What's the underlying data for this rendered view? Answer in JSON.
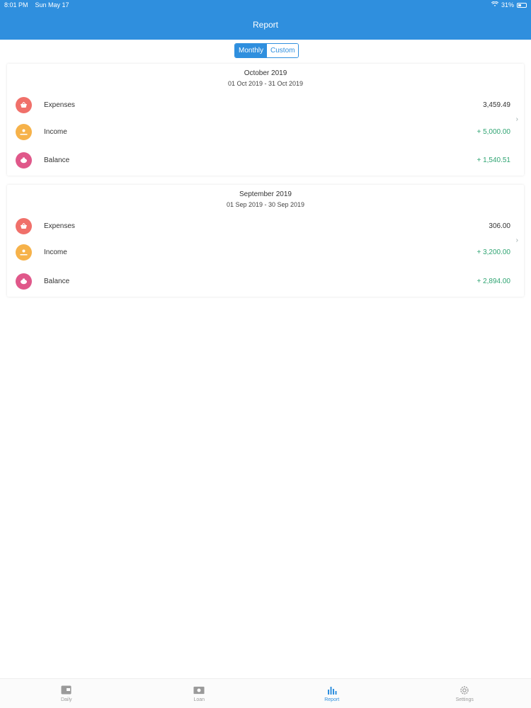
{
  "status_bar": {
    "time": "8:01 PM",
    "date": "Sun May 17",
    "battery": "31%"
  },
  "header": {
    "title": "Report"
  },
  "segments": [
    {
      "label": "Monthly",
      "active": true
    },
    {
      "label": "Custom",
      "active": false
    }
  ],
  "reports": [
    {
      "title": "October 2019",
      "range": "01 Oct 2019 - 31 Oct 2019",
      "rows": [
        {
          "label": "Expenses",
          "value": "3,459.49",
          "icon": "basket-icon",
          "color": "#f0706a"
        },
        {
          "label": "Income",
          "value": "+ 5,000.00",
          "icon": "hand-coin-icon",
          "color": "#f6b24a"
        },
        {
          "label": "Balance",
          "value": "+ 1,540.51",
          "icon": "piggy-bank-icon",
          "color": "#e0588a"
        }
      ]
    },
    {
      "title": "September 2019",
      "range": "01 Sep 2019 - 30 Sep 2019",
      "rows": [
        {
          "label": "Expenses",
          "value": "306.00",
          "icon": "basket-icon",
          "color": "#f0706a"
        },
        {
          "label": "Income",
          "value": "+ 3,200.00",
          "icon": "hand-coin-icon",
          "color": "#f6b24a"
        },
        {
          "label": "Balance",
          "value": "+ 2,894.00",
          "icon": "piggy-bank-icon",
          "color": "#e0588a"
        }
      ]
    }
  ],
  "tabs": [
    {
      "label": "Daily",
      "icon": "wallet-icon",
      "active": false
    },
    {
      "label": "Loan",
      "icon": "banknote-icon",
      "active": false
    },
    {
      "label": "Report",
      "icon": "bar-chart-icon",
      "active": true
    },
    {
      "label": "Settings",
      "icon": "gear-icon",
      "active": false
    }
  ],
  "colors": {
    "primary": "#2f8fde",
    "positive": "#2fa472"
  }
}
